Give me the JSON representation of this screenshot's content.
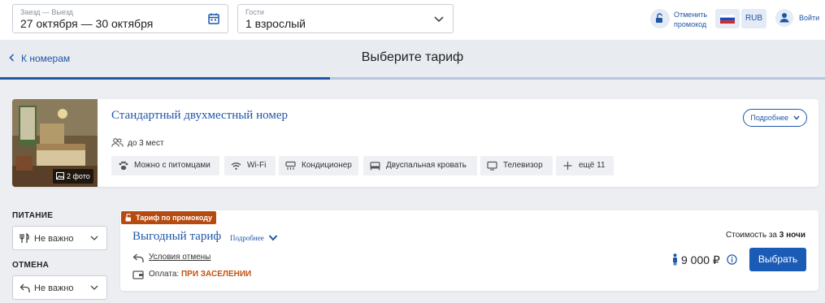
{
  "search": {
    "dates_label": "Заезд — Выезд",
    "dates_value": "27 октября — 30 октября",
    "guests_label": "Гости",
    "guests_value": "1 взрослый"
  },
  "header": {
    "promo_line1": "Отменить",
    "promo_line2": "промокод",
    "currency": "RUB",
    "login": "Войти"
  },
  "nav": {
    "back": "К номерам",
    "title": "Выберите тариф",
    "progress": 0.4
  },
  "room": {
    "name": "Стандартный двухместный номер",
    "more": "Подробнее",
    "photos": "2 фото",
    "capacity": "до 3 мест",
    "amenities": [
      {
        "label": "Можно с питомцами",
        "icon": "paw-icon"
      },
      {
        "label": "Wi-Fi",
        "icon": "wifi-icon"
      },
      {
        "label": "Кондиционер",
        "icon": "air-conditioner-icon"
      },
      {
        "label": "Двуспальная кровать",
        "icon": "bed-icon"
      },
      {
        "label": "Телевизор",
        "icon": "tv-icon"
      },
      {
        "label": "ещё 11",
        "icon": "plus-icon"
      }
    ]
  },
  "filters": {
    "meal_title": "ПИТАНИЕ",
    "meal_value": "Не важно",
    "cancel_title": "ОТМЕНА",
    "cancel_value": "Не важно"
  },
  "rate": {
    "badge": "Тариф по промокоду",
    "name": "Выгодный тариф",
    "more": "Подробнее",
    "cancel_conditions": "Условия отмены",
    "payment_label": "Оплата:",
    "payment_value": "ПРИ ЗАСЕЛЕНИИ",
    "cost_label": "Стоимость за",
    "nights": "3 ночи",
    "price": "9 000 ₽",
    "select": "Выбрать"
  },
  "colors": {
    "accent": "#1f56a8",
    "button": "#1a5bb6",
    "promo_badge": "#b74a10",
    "payment_highlight": "#c2520f"
  }
}
